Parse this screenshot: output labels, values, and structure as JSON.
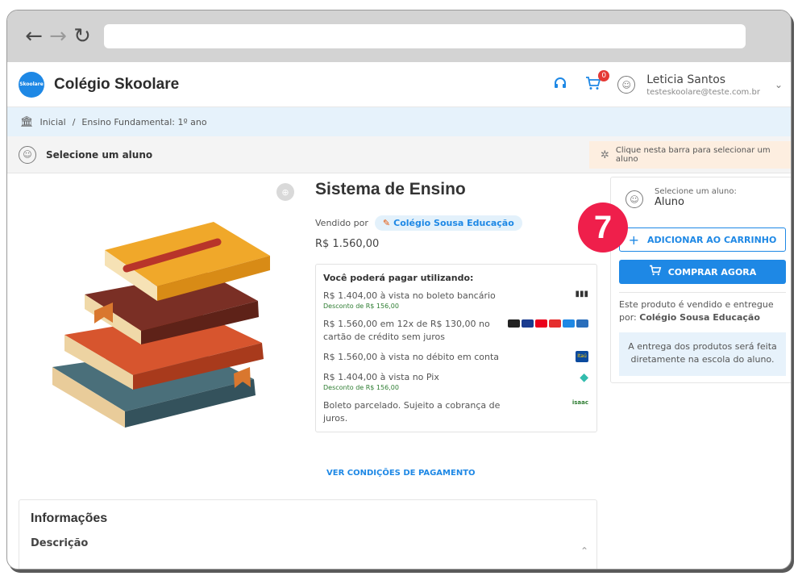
{
  "browser": {
    "back_icon": "arrow-left",
    "forward_icon": "arrow-right",
    "reload_icon": "reload"
  },
  "header": {
    "logo_text": "Skoolare",
    "app_name": "Colégio Skoolare",
    "cart_count": "0",
    "user_name": "Leticia Santos",
    "user_email": "testeskoolare@teste.com.br"
  },
  "breadcrumb": {
    "home": "Inicial",
    "separator": "/",
    "current": "Ensino Fundamental: 1º ano"
  },
  "student_bar": {
    "label": "Selecione um aluno",
    "hint": "Clique nesta barra para selecionar um aluno"
  },
  "product": {
    "title": "Sistema de Ensino",
    "sold_by_label": "Vendido por",
    "seller": "Colégio Sousa Educação",
    "price": "R$ 1.560,00",
    "payment_header": "Você poderá pagar utilizando:",
    "payments": [
      {
        "text": "R$ 1.404,00 à vista no boleto bancário",
        "discount": "Desconto de R$ 156,00",
        "icon": "barcode-icon"
      },
      {
        "text": "R$ 1.560,00 em 12x de R$ 130,00 no cartão de crédito sem juros",
        "discount": "",
        "icon": "card-brands-icon"
      },
      {
        "text": "R$ 1.560,00 à vista no débito em conta",
        "discount": "",
        "icon": "itau-icon"
      },
      {
        "text": "R$ 1.404,00 à vista no Pix",
        "discount": "Desconto de R$ 156,00",
        "icon": "pix-icon"
      },
      {
        "text": "Boleto parcelado. Sujeito a cobrança de juros.",
        "discount": "",
        "icon": "isaac-icon"
      }
    ],
    "itau_text": "Itaú",
    "isaac_text": "isaac",
    "payment_link": "VER CONDIÇÕES DE PAGAMENTO"
  },
  "info": {
    "title": "Informações",
    "description_label": "Descrição"
  },
  "sidebar": {
    "select_label": "Selecione um aluno:",
    "select_value": "Aluno",
    "add_to_cart": "ADICIONAR AO CARRINHO",
    "buy_now": "COMPRAR AGORA",
    "sold_info_prefix": "Este produto é vendido e entregue por:",
    "sold_info_seller": "Colégio Sousa Educação",
    "delivery_note": "A entrega dos produtos será feita diretamente na escola do aluno."
  },
  "step_marker": "7",
  "colors": {
    "accent": "#1e88e5",
    "step": "#ef1f4b"
  }
}
